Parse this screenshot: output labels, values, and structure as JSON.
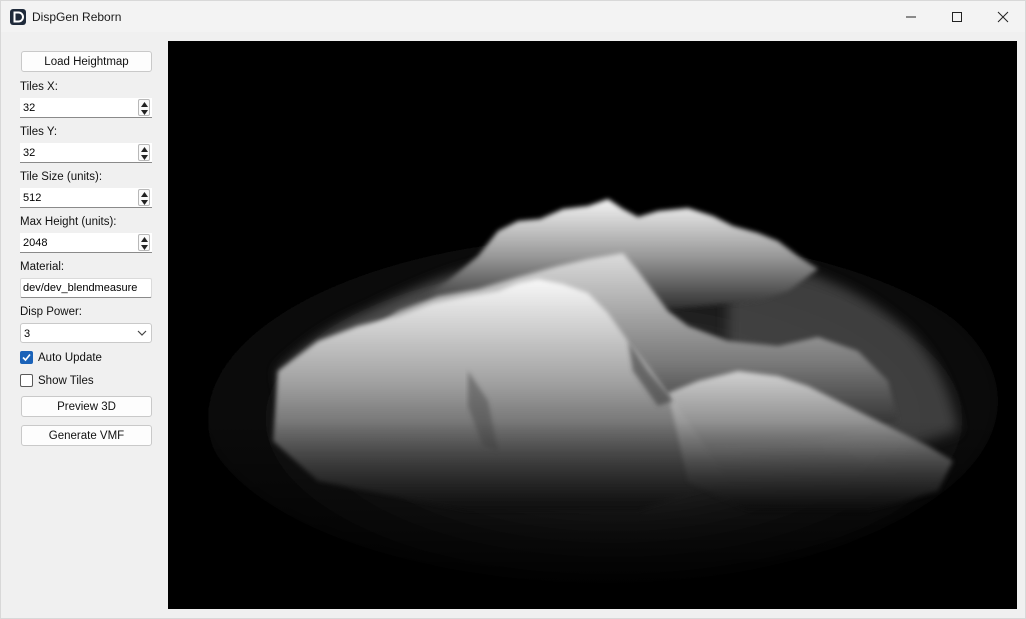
{
  "window": {
    "title": "DispGen Reborn"
  },
  "controls": {
    "load_button": "Load Heightmap",
    "tiles_x": {
      "label": "Tiles X:",
      "value": "32"
    },
    "tiles_y": {
      "label": "Tiles Y:",
      "value": "32"
    },
    "tile_size": {
      "label": "Tile Size (units):",
      "value": "512"
    },
    "max_height": {
      "label": "Max Height (units):",
      "value": "2048"
    },
    "material": {
      "label": "Material:",
      "value": "dev/dev_blendmeasure"
    },
    "disp_power": {
      "label": "Disp Power:",
      "value": "3"
    },
    "auto_update": {
      "label": "Auto Update",
      "checked": true
    },
    "show_tiles": {
      "label": "Show Tiles",
      "checked": false
    },
    "preview_button": "Preview 3D",
    "generate_button": "Generate VMF"
  },
  "viewport": {
    "background": "#000000"
  }
}
